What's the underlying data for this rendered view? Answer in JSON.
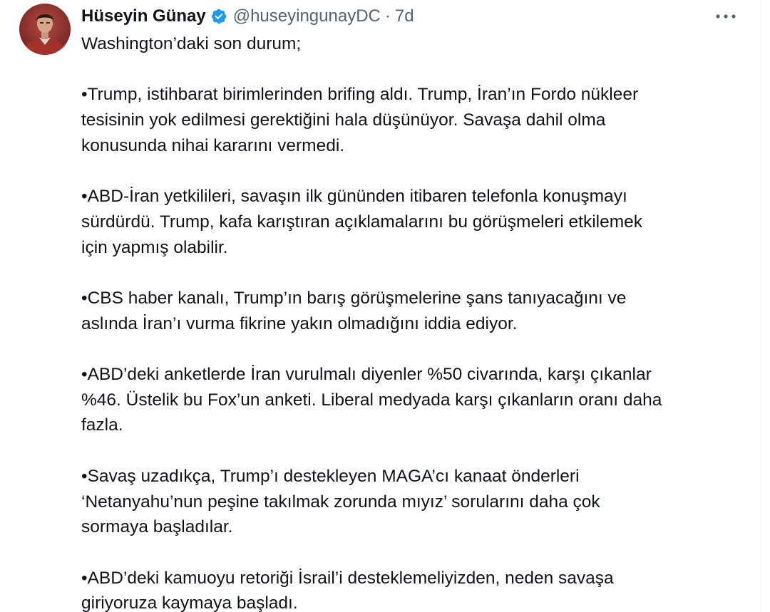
{
  "tweet": {
    "author": {
      "display_name": "Hüseyin Günay",
      "handle": "@huseyingunayDC",
      "verified": true,
      "verified_icon": "verified-badge-icon",
      "avatar_icon": "avatar-photo"
    },
    "separator": "·",
    "time": "7d",
    "more_icon": "more-options-icon",
    "paragraphs": [
      "Washington’daki son durum;",
      "•Trump, istihbarat birimlerinden brifing aldı. Trump, İran’ın Fordo nükleer\ntesisinin yok edilmesi gerektiğini hala düşünüyor.  Savaşa dahil olma\nkonusunda nihai kararını vermedi.",
      "•ABD-İran yetkilileri, savaşın ilk gününden itibaren telefonla konuşmayı\nsürdürdü. Trump, kafa karıştıran açıklamalarını bu görüşmeleri etkilemek\niçin yapmış olabilir.",
      "•CBS haber kanalı, Trump’ın barış görüşmelerine şans tanıyacağını ve\naslında İran’ı vurma fikrine yakın olmadığını iddia ediyor.",
      "•ABD’deki anketlerde İran vurulmalı diyenler %50 civarında, karşı çıkanlar\n%46. Üstelik bu Fox’un anketi. Liberal medyada karşı çıkanların oranı daha\nfazla.",
      "•Savaş uzadıkça, Trump’ı destekleyen MAGA’cı kanaat önderleri\n‘Netanyahu’nun peşine takılmak zorunda mıyız’ sorularını daha çok\nsormaya başladılar.",
      "•ABD’deki kamuoyu retoriği İsrail’i desteklemeliyizden, neden savaşa\ngiriyoruza kaymaya başladı."
    ]
  },
  "colors": {
    "text_primary": "#0f1419",
    "text_secondary": "#536471",
    "verified_blue": "#1d9bf0",
    "divider": "#eff3f4"
  }
}
